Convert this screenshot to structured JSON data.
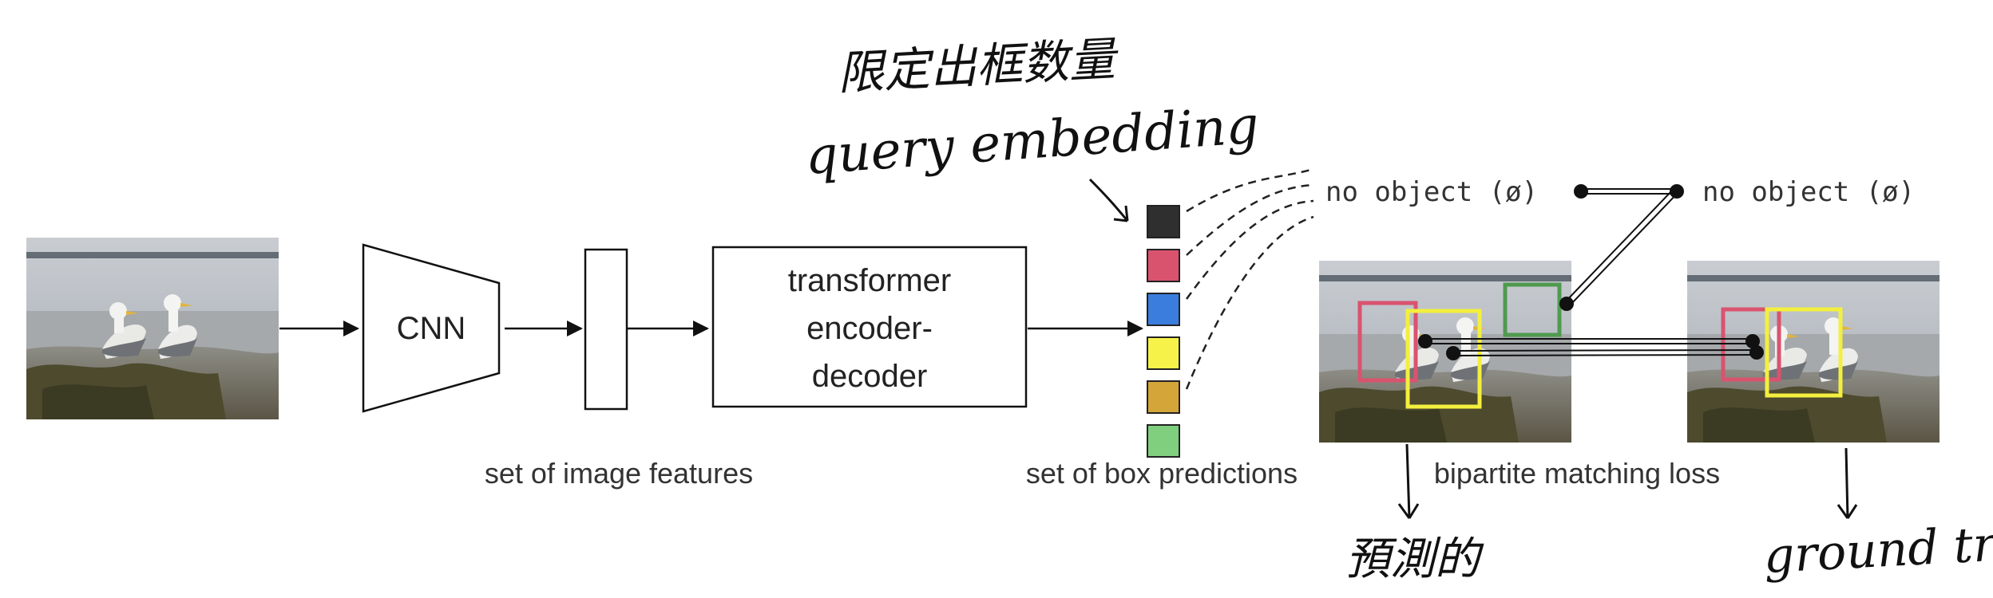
{
  "diagram": {
    "blocks": {
      "cnn": "CNN",
      "transformer": [
        "transformer",
        "encoder-",
        "decoder"
      ]
    },
    "labels": {
      "image_features": "set of image features",
      "box_predictions": "set of box predictions",
      "matching_loss": "bipartite matching loss",
      "no_object_pred": "no object (ø)",
      "no_object_gt": "no object (ø)"
    },
    "prediction_colors": [
      "#2f2f2f",
      "#d9536f",
      "#3b7ddd",
      "#f7f24a",
      "#d4a63a",
      "#7fcf7f"
    ],
    "box_colors": {
      "pink": "#d9536f",
      "yellow": "#f3ef3e",
      "green": "#4f9a4f"
    },
    "annotations": {
      "top_chinese": "限定出框数量",
      "query": "query embedding",
      "pred_chinese": "預測的",
      "ground_truth": "ground truth"
    }
  }
}
